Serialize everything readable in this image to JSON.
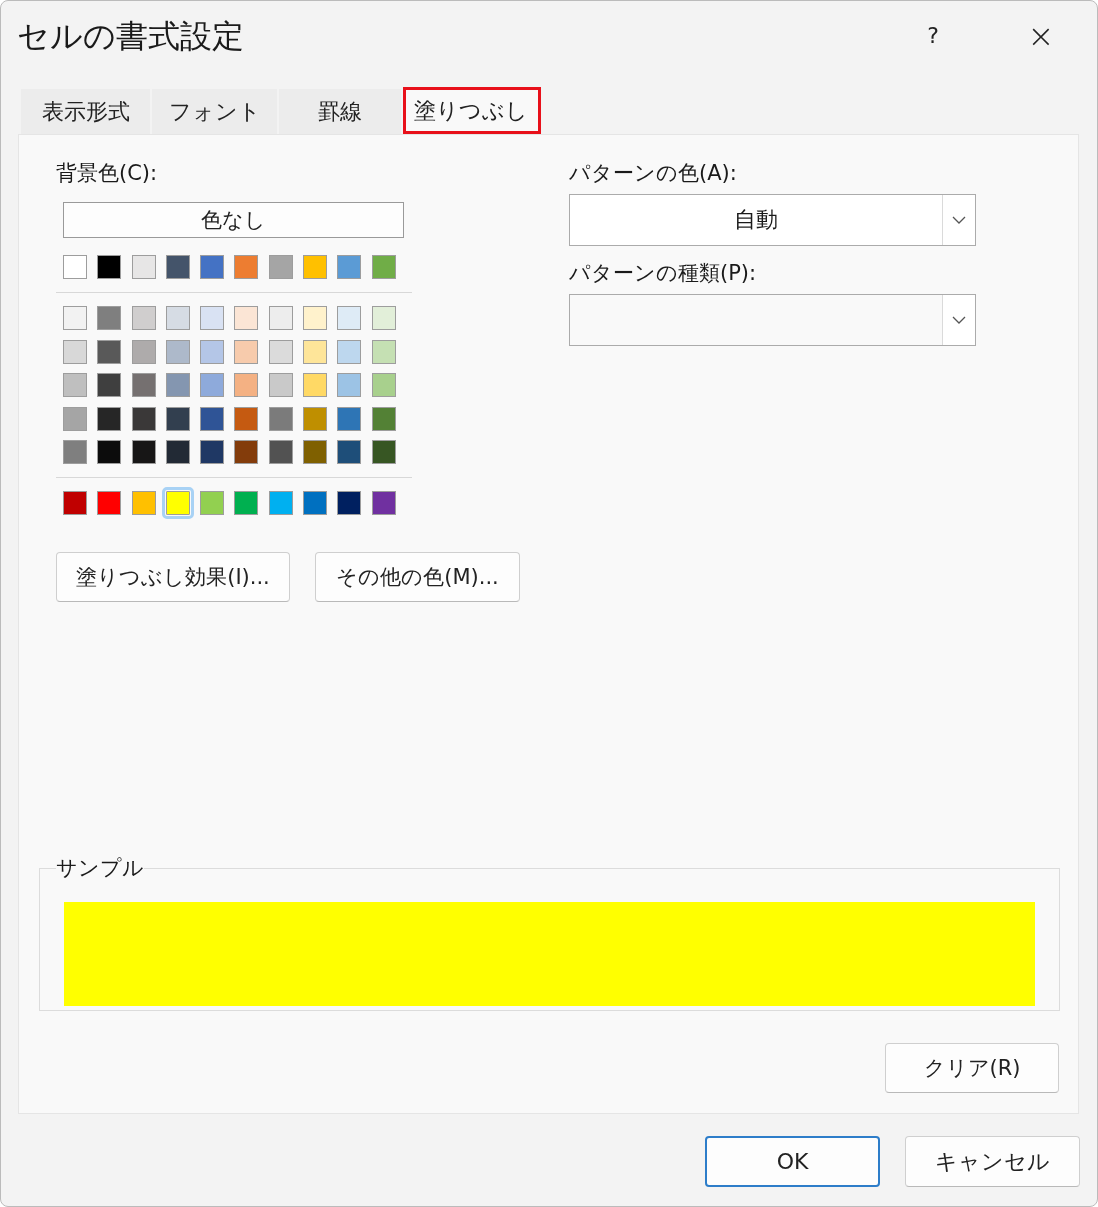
{
  "window": {
    "title": "セルの書式設定",
    "help": "?",
    "close": "×"
  },
  "tabs": [
    {
      "label": "表示形式",
      "selected": false,
      "highlighted": false
    },
    {
      "label": "フォント",
      "selected": false,
      "highlighted": false
    },
    {
      "label": "罫線",
      "selected": false,
      "highlighted": false
    },
    {
      "label": "塗りつぶし",
      "selected": true,
      "highlighted": true
    }
  ],
  "background": {
    "label": "背景色(C):",
    "no_color_button": "色なし",
    "theme_row": [
      {
        "color": "#ffffff",
        "selected": false
      },
      {
        "color": "#000000",
        "selected": false
      },
      {
        "color": "#e7e6e6",
        "selected": false
      },
      {
        "color": "#44546a",
        "selected": false
      },
      {
        "color": "#4472c4",
        "selected": false
      },
      {
        "color": "#ed7d31",
        "selected": false
      },
      {
        "color": "#a5a5a5",
        "selected": false
      },
      {
        "color": "#ffc000",
        "selected": false
      },
      {
        "color": "#5b9bd5",
        "selected": false
      },
      {
        "color": "#70ad47",
        "selected": false
      }
    ],
    "shade_rows": [
      [
        {
          "color": "#f2f2f2",
          "selected": false
        },
        {
          "color": "#7f7f7f",
          "selected": false
        },
        {
          "color": "#d0cece",
          "selected": false
        },
        {
          "color": "#d6dce4",
          "selected": false
        },
        {
          "color": "#d9e2f3",
          "selected": false
        },
        {
          "color": "#fbe5d5",
          "selected": false
        },
        {
          "color": "#ededed",
          "selected": false
        },
        {
          "color": "#fff2cc",
          "selected": false
        },
        {
          "color": "#deebf6",
          "selected": false
        },
        {
          "color": "#e2efd9",
          "selected": false
        }
      ],
      [
        {
          "color": "#d8d8d8",
          "selected": false
        },
        {
          "color": "#595959",
          "selected": false
        },
        {
          "color": "#aeabab",
          "selected": false
        },
        {
          "color": "#adb9ca",
          "selected": false
        },
        {
          "color": "#b4c6e7",
          "selected": false
        },
        {
          "color": "#f7cbac",
          "selected": false
        },
        {
          "color": "#dbdbdb",
          "selected": false
        },
        {
          "color": "#fee599",
          "selected": false
        },
        {
          "color": "#bdd7ee",
          "selected": false
        },
        {
          "color": "#c5e0b3",
          "selected": false
        }
      ],
      [
        {
          "color": "#bfbfbf",
          "selected": false
        },
        {
          "color": "#3f3f3f",
          "selected": false
        },
        {
          "color": "#757070",
          "selected": false
        },
        {
          "color": "#8496b0",
          "selected": false
        },
        {
          "color": "#8eaadb",
          "selected": false
        },
        {
          "color": "#f4b183",
          "selected": false
        },
        {
          "color": "#c9c9c9",
          "selected": false
        },
        {
          "color": "#ffd965",
          "selected": false
        },
        {
          "color": "#9cc3e5",
          "selected": false
        },
        {
          "color": "#a8d08d",
          "selected": false
        }
      ],
      [
        {
          "color": "#a5a5a5",
          "selected": false
        },
        {
          "color": "#262626",
          "selected": false
        },
        {
          "color": "#3a3838",
          "selected": false
        },
        {
          "color": "#323f4f",
          "selected": false
        },
        {
          "color": "#2f5496",
          "selected": false
        },
        {
          "color": "#c55a11",
          "selected": false
        },
        {
          "color": "#7b7b7b",
          "selected": false
        },
        {
          "color": "#bf8f00",
          "selected": false
        },
        {
          "color": "#2e75b5",
          "selected": false
        },
        {
          "color": "#538135",
          "selected": false
        }
      ],
      [
        {
          "color": "#7f7f7f",
          "selected": false
        },
        {
          "color": "#0c0c0c",
          "selected": false
        },
        {
          "color": "#171616",
          "selected": false
        },
        {
          "color": "#222a35",
          "selected": false
        },
        {
          "color": "#1f3864",
          "selected": false
        },
        {
          "color": "#833c0b",
          "selected": false
        },
        {
          "color": "#525252",
          "selected": false
        },
        {
          "color": "#7f6000",
          "selected": false
        },
        {
          "color": "#1e4e79",
          "selected": false
        },
        {
          "color": "#375623",
          "selected": false
        }
      ]
    ],
    "standard_row": [
      {
        "color": "#c00000",
        "selected": false
      },
      {
        "color": "#ff0000",
        "selected": false
      },
      {
        "color": "#ffc000",
        "selected": false
      },
      {
        "color": "#ffff00",
        "selected": true
      },
      {
        "color": "#92d050",
        "selected": false
      },
      {
        "color": "#00b050",
        "selected": false
      },
      {
        "color": "#00b0f0",
        "selected": false
      },
      {
        "color": "#0070c0",
        "selected": false
      },
      {
        "color": "#002060",
        "selected": false
      },
      {
        "color": "#7030a0",
        "selected": false
      }
    ],
    "buttons": [
      "塗りつぶし効果(I)...",
      "その他の色(M)..."
    ]
  },
  "pattern_color": {
    "label": "パターンの色(A):",
    "value": "自動"
  },
  "pattern_style": {
    "label": "パターンの種類(P):"
  },
  "sample": {
    "label": "サンプル",
    "color": "#ffff00"
  },
  "clear_button": "クリア(R)",
  "footer_buttons": [
    {
      "label": "OK",
      "selected": true
    },
    {
      "label": "キャンセル",
      "selected": false
    }
  ]
}
